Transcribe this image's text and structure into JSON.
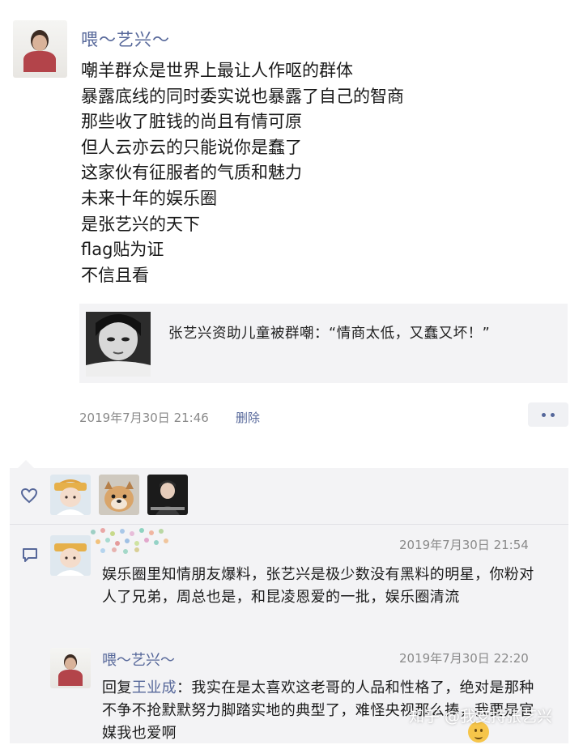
{
  "post": {
    "author": "喂～艺兴～",
    "lines": [
      "嘲羊群众是世界上最让人作呕的群体",
      "暴露底线的同时委实说也暴露了自己的智商",
      "那些收了脏钱的尚且有情可原",
      "但人云亦云的只能说你是蠢了",
      "这家伙有征服者的气质和魅力",
      "未来十年的娱乐圈",
      "是张艺兴的天下",
      "flag贴为证",
      "不信且看"
    ],
    "link_title": "张艺兴资助儿童被群嘲：“情商太低，又蠢又坏！”",
    "timestamp": "2019年7月30日  21:46",
    "delete_label": "删除"
  },
  "comments": [
    {
      "timestamp": "2019年7月30日  21:54",
      "text": "娱乐圈里知情朋友爆料，张艺兴是极少数没有黑料的明星，你粉对人了兄弟，周总也是，和昆凌恩爱的一批，娱乐圈清流"
    },
    {
      "author": "喂～艺兴～",
      "timestamp": "2019年7月30日  22:20",
      "reply_prefix": "回复",
      "reply_to": "王业成",
      "text": "：我实在是太喜欢这老哥的人品和性格了，绝对是那种不争不抢默默努力脚踏实地的典型了，难怪央视那么捧，我要是官媒我也爱啊"
    }
  ],
  "watermark": "知乎 @我支持张艺兴",
  "colors": {
    "link": "#57689a",
    "panel": "#f3f3f5",
    "meta": "#8a8a8a"
  },
  "icons": {
    "like": "heart-icon",
    "comment": "comment-icon",
    "more": "more-dots-icon"
  }
}
